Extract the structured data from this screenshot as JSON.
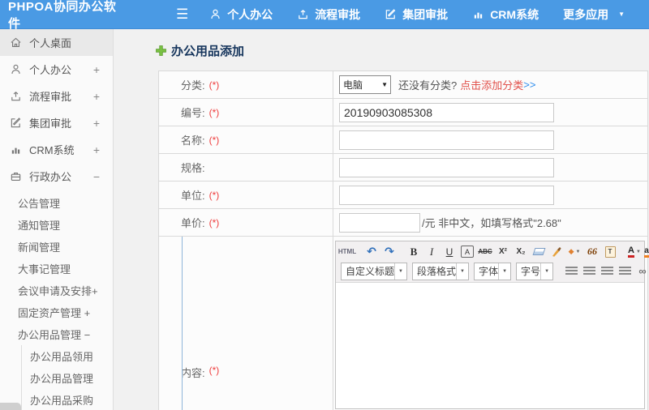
{
  "colors": {
    "topbar": "#4a9ae4",
    "link_blue": "#2e8ded",
    "link_red": "#e1504a",
    "title_navy": "#17365d",
    "required_red": "#ee3b3b",
    "title_plus_green": "#7ac143"
  },
  "topbar": {
    "brand": "PHPOA协同办公软件",
    "menu_glyph": "☰",
    "nav": [
      {
        "icon": "user-icon",
        "label": "个人办公"
      },
      {
        "icon": "flow-icon",
        "label": "流程审批"
      },
      {
        "icon": "edit-icon",
        "label": "集团审批"
      },
      {
        "icon": "chart-icon",
        "label": "CRM系统"
      },
      {
        "icon": "caret-down-icon",
        "label": "更多应用",
        "caret": "▼"
      }
    ]
  },
  "sidebar": {
    "items": [
      {
        "icon": "home-icon",
        "label": "个人桌面",
        "expand": ""
      },
      {
        "icon": "user-icon",
        "label": "个人办公",
        "expand": "+"
      },
      {
        "icon": "flow-icon",
        "label": "流程审批",
        "expand": "+"
      },
      {
        "icon": "edit-icon",
        "label": "集团审批",
        "expand": "+"
      },
      {
        "icon": "chart-icon",
        "label": "CRM系统",
        "expand": "+"
      },
      {
        "icon": "briefcase-icon",
        "label": "行政办公",
        "expand": "−"
      }
    ],
    "sub_items": [
      "公告管理",
      "通知管理",
      "新闻管理",
      "大事记管理",
      "会议申请及安排+",
      "固定资产管理 +",
      "办公用品管理 −"
    ],
    "nested_items": [
      "办公用品领用",
      "办公用品管理",
      "办公用品采购"
    ]
  },
  "main": {
    "title": "办公用品添加",
    "form": {
      "category": {
        "label": "分类:",
        "required": "(*)",
        "select_value": "电脑",
        "caret": "▼",
        "hint": "还没有分类?",
        "link": "点击添加分类",
        "arrows": ">>"
      },
      "code": {
        "label": "编号:",
        "required": "(*)",
        "value": "20190903085308"
      },
      "name": {
        "label": "名称:",
        "required": "(*)",
        "value": ""
      },
      "spec": {
        "label": "规格:",
        "required": "",
        "value": ""
      },
      "unit": {
        "label": "单位:",
        "required": "(*)",
        "value": ""
      },
      "price": {
        "label": "单价:",
        "required": "(*)",
        "value": "",
        "note": "/元 非中文，如填写格式\"2.68\""
      },
      "content": {
        "label": "内容:",
        "required": "(*)"
      }
    },
    "editor": {
      "caret": "▼",
      "toolbar1": [
        {
          "name": "source",
          "glyph": "HTML"
        },
        {
          "name": "undo",
          "glyph": "↶"
        },
        {
          "name": "redo",
          "glyph": "↷"
        },
        {
          "name": "bold",
          "glyph": "B"
        },
        {
          "name": "italic",
          "glyph": "I"
        },
        {
          "name": "underline",
          "glyph": "U"
        },
        {
          "name": "font-box",
          "glyph": "A"
        },
        {
          "name": "strikethrough",
          "glyph": "ABC"
        },
        {
          "name": "superscript",
          "glyph": "X²"
        },
        {
          "name": "subscript",
          "glyph": "X₂"
        },
        {
          "name": "format-painter",
          "glyph": "◆"
        },
        {
          "name": "blockquote",
          "glyph": "66"
        },
        {
          "name": "paste-text",
          "glyph": "T"
        },
        {
          "name": "font-color",
          "glyph": "A"
        },
        {
          "name": "highlight",
          "glyph": "ab"
        }
      ],
      "selects": [
        "自定义标题",
        "段落格式",
        "字体",
        "字号"
      ],
      "link_icon": "∞"
    }
  }
}
